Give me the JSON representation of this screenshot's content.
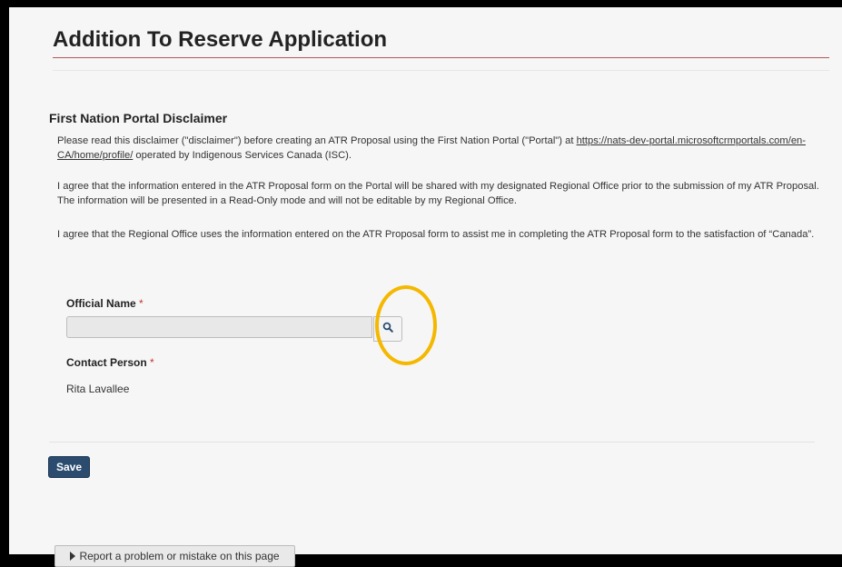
{
  "page": {
    "title": "Addition To Reserve Application"
  },
  "disclaimer": {
    "heading": "First Nation Portal Disclaimer",
    "p1_before_link": "Please read this disclaimer (\"disclaimer\") before creating an ATR Proposal using the First Nation Portal (\"Portal\") at ",
    "p1_link": "https://nats-dev-portal.microsoftcrmportals.com/en-CA/home/profile/",
    "p1_after_link": " operated by Indigenous Services Canada (ISC).",
    "p2": "I agree that the information entered in the ATR Proposal form on the Portal will be shared with my designated Regional Office prior to the submission of my ATR Proposal. The information will be presented in a Read-Only mode and will not be editable by my Regional Office.",
    "p3": "I agree that the Regional Office uses the information entered on the ATR Proposal form to assist me in completing the ATR Proposal form to the satisfaction of “Canada”."
  },
  "form": {
    "official_name_label": "Official Name",
    "official_name_value": "",
    "required_mark": "*",
    "search_icon": "search-icon",
    "contact_person_label": "Contact Person",
    "contact_person_value": "Rita Lavallee"
  },
  "actions": {
    "save_label": "Save",
    "report_label": "Report a problem or mistake on this page"
  },
  "colors": {
    "primary_button": "#2b4c6f",
    "highlight": "#f4b800",
    "title_rule": "#b3565a",
    "required": "#c0392b"
  }
}
